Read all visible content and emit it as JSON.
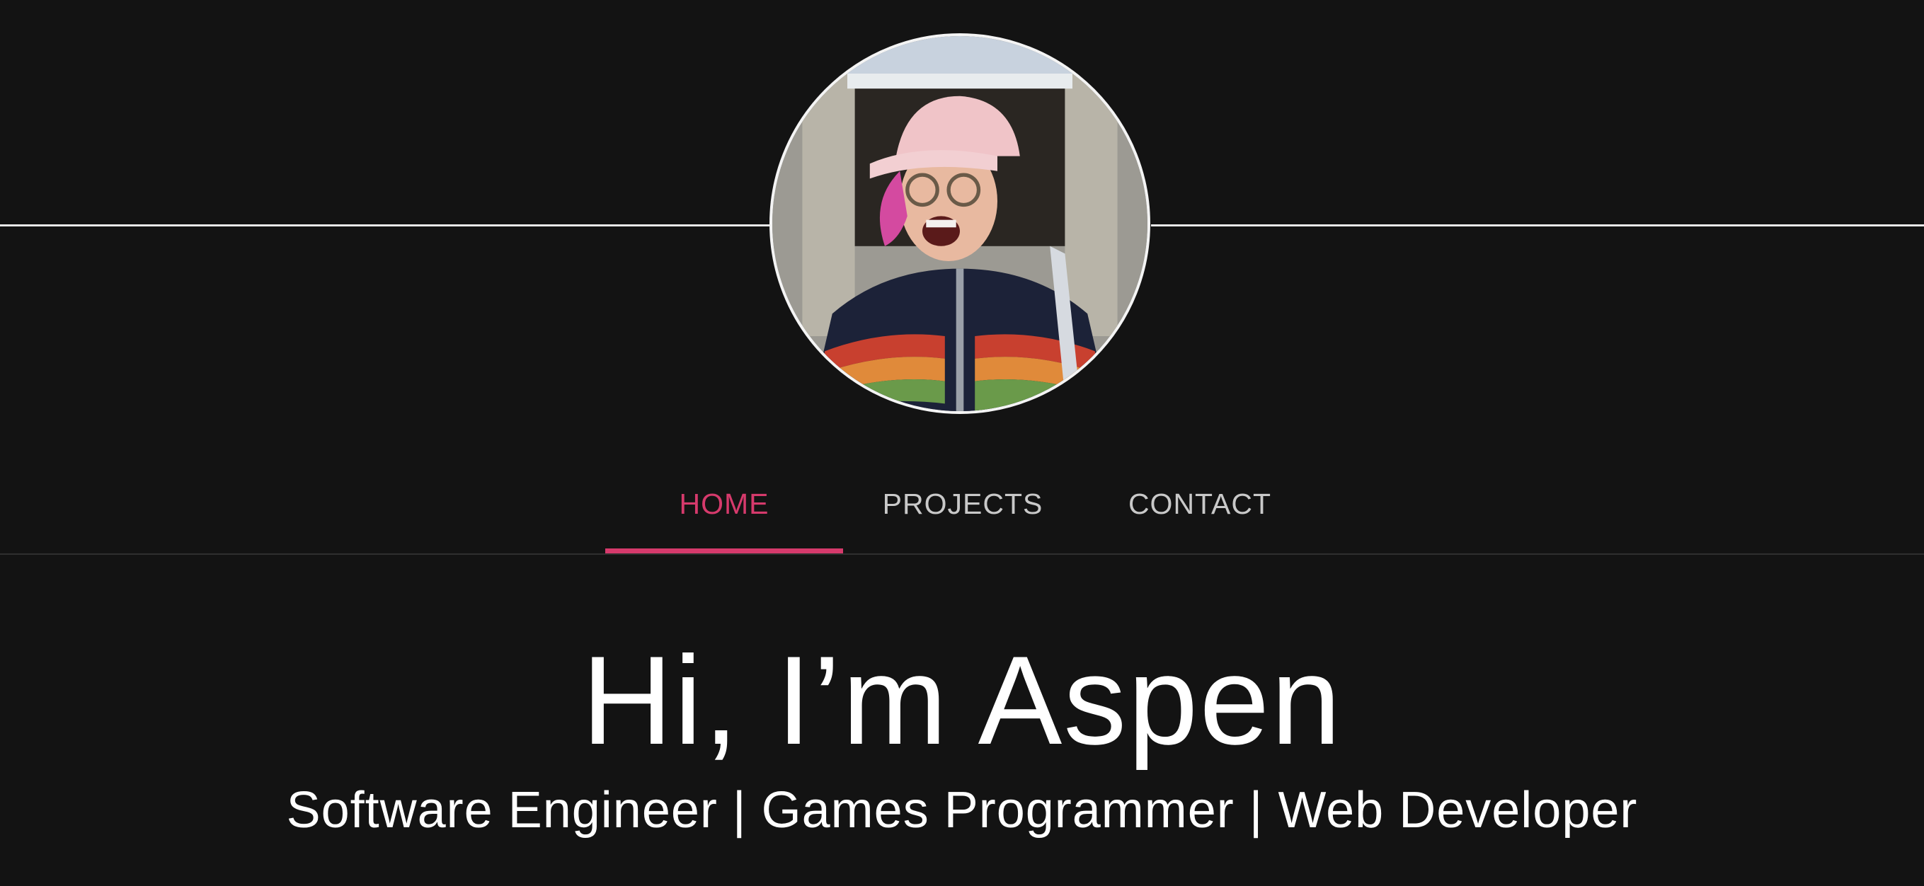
{
  "profile": {
    "avatar_alt": "Aspen profile photo"
  },
  "nav": {
    "items": [
      {
        "label": "HOME",
        "active": true
      },
      {
        "label": "PROJECTS",
        "active": false
      },
      {
        "label": "CONTACT",
        "active": false
      }
    ]
  },
  "hero": {
    "title": "Hi, I’m Aspen",
    "subtitle": "Software Engineer | Games Programmer | Web Developer"
  },
  "colors": {
    "background": "#131313",
    "accent": "#d63a6c",
    "nav_text": "#c9c9c9",
    "text": "#ffffff"
  }
}
